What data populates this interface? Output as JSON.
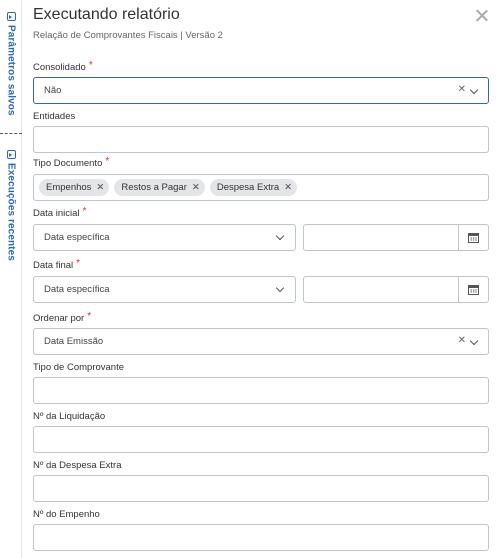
{
  "rail": {
    "saved_params": "Parâmetros salvos",
    "recent_runs": "Execuções recentes"
  },
  "header": {
    "title": "Executando relatório",
    "subtitle": "Relação de Comprovantes Fiscais | Versão 2"
  },
  "fields": {
    "consolidado": {
      "label": "Consolidado",
      "required": "*",
      "value": "Não",
      "clear": "✕"
    },
    "entidades": {
      "label": "Entidades",
      "value": ""
    },
    "tipo_documento": {
      "label": "Tipo Documento",
      "required": "*",
      "chips": [
        "Empenhos",
        "Restos a Pagar",
        "Despesa Extra"
      ],
      "remove": "✕"
    },
    "data_inicial": {
      "label": "Data inicial",
      "required": "*",
      "mode": "Data específica",
      "date": ""
    },
    "data_final": {
      "label": "Data final",
      "required": "*",
      "mode": "Data específica",
      "date": ""
    },
    "ordenar_por": {
      "label": "Ordenar por",
      "required": "*",
      "value": "Data Emissão",
      "clear": "✕"
    },
    "tipo_comprovante": {
      "label": "Tipo de Comprovante",
      "value": ""
    },
    "num_liquidacao": {
      "label": "Nº da Liquidação",
      "value": ""
    },
    "num_despesa_extra": {
      "label": "Nº da Despesa Extra",
      "value": ""
    },
    "num_empenho": {
      "label": "Nº do Empenho",
      "value": ""
    }
  },
  "colors": {
    "accent": "#2a6ab8",
    "required": "#d9322b",
    "border": "#bfc5cc",
    "chip_bg": "#e3e5e8"
  }
}
